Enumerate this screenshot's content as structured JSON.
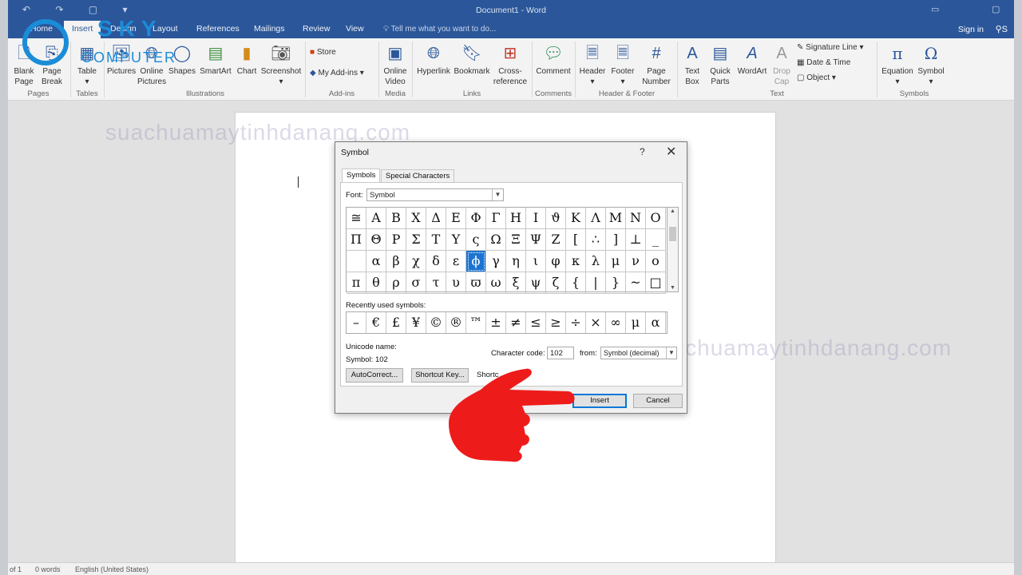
{
  "titlebar": {
    "qat": "↶ ↷ ▢ ▾",
    "title": "Document1 - Word",
    "min": "▭",
    "restore": "▢"
  },
  "tabs": {
    "home": "Home",
    "insert": "Insert",
    "design": "Design",
    "layout": "Layout",
    "references": "References",
    "mailings": "Mailings",
    "review": "Review",
    "view": "View",
    "tellme": "Tell me what you want to do...",
    "signin": "Sign in",
    "share": "S"
  },
  "ribbon": {
    "blank_page": "Blank\nPage",
    "page_break": "Page\nBreak",
    "table": "Table",
    "pictures": "Pictures",
    "online_pictures": "Online\nPictures",
    "shapes": "Shapes",
    "smartart": "SmartArt",
    "chart": "Chart",
    "screenshot": "Screenshot",
    "store": "Store",
    "my_addins": "My Add-ins",
    "online_video": "Online\nVideo",
    "hyperlink": "Hyperlink",
    "bookmark": "Bookmark",
    "cross_reference": "Cross-\nreference",
    "comment": "Comment",
    "header": "Header",
    "footer": "Footer",
    "page_number": "Page\nNumber",
    "text_box": "Text\nBox",
    "quick_parts": "Quick\nParts",
    "wordart": "WordArt",
    "drop_cap": "Drop\nCap",
    "signature_line": "Signature Line",
    "date_time": "Date & Time",
    "object": "Object",
    "equation": "Equation",
    "symbol": "Symbol",
    "groups": {
      "pages": "Pages",
      "tables": "Tables",
      "illustrations": "Illustrations",
      "addins": "Add-ins",
      "media": "Media",
      "links": "Links",
      "comments": "Comments",
      "header_footer": "Header & Footer",
      "text": "Text",
      "symbols": "Symbols"
    }
  },
  "watermark": {
    "logo_sky": "SKY",
    "logo_computer": "COMPUTER",
    "site1": "suachuamaytinhdanang.com",
    "site2": "suachuamaytinhdanang.com"
  },
  "dialog": {
    "title": "Symbol",
    "help": "?",
    "close": "✕",
    "tab_symbols": "Symbols",
    "tab_special": "Special Characters",
    "font_label": "Font:",
    "font_value": "Symbol",
    "symbols": [
      "≅",
      "Α",
      "Β",
      "Χ",
      "Δ",
      "Ε",
      "Φ",
      "Γ",
      "Η",
      "Ι",
      "ϑ",
      "Κ",
      "Λ",
      "Μ",
      "Ν",
      "Ο",
      "Π",
      "Θ",
      "Ρ",
      "Σ",
      "Τ",
      "Υ",
      "ς",
      "Ω",
      "Ξ",
      "Ψ",
      "Ζ",
      "[",
      "∴",
      "]",
      "⊥",
      "_",
      "",
      "α",
      "β",
      "χ",
      "δ",
      "ε",
      "ϕ",
      "γ",
      "η",
      "ι",
      "φ",
      "κ",
      "λ",
      "μ",
      "ν",
      "ο",
      "π",
      "θ",
      "ρ",
      "σ",
      "τ",
      "υ",
      "ϖ",
      "ω",
      "ξ",
      "ψ",
      "ζ",
      "{",
      "|",
      "}",
      "~",
      "□"
    ],
    "selected_index": 38,
    "recent_label": "Recently used symbols:",
    "recent": [
      "–",
      "€",
      "£",
      "¥",
      "©",
      "®",
      "™",
      "±",
      "≠",
      "≤",
      "≥",
      "÷",
      "×",
      "∞",
      "μ",
      "α"
    ],
    "unicode_name_label": "Unicode name:",
    "unicode_name": "Symbol: 102",
    "char_code_label": "Character code:",
    "char_code": "102",
    "from_label": "from:",
    "from_value": "Symbol (decimal)",
    "autocorrect": "AutoCorrect...",
    "shortcut_key": "Shortcut Key...",
    "shortcut_text": "Shortc",
    "insert": "Insert",
    "cancel": "Cancel"
  },
  "status": {
    "page": "of 1",
    "words": "0 words",
    "lang": "English (United States)"
  },
  "colors": {
    "word_blue": "#2b579a",
    "selection": "#1c74d1",
    "hand": "#ee1b1b",
    "logo": "#1a8cd8"
  }
}
